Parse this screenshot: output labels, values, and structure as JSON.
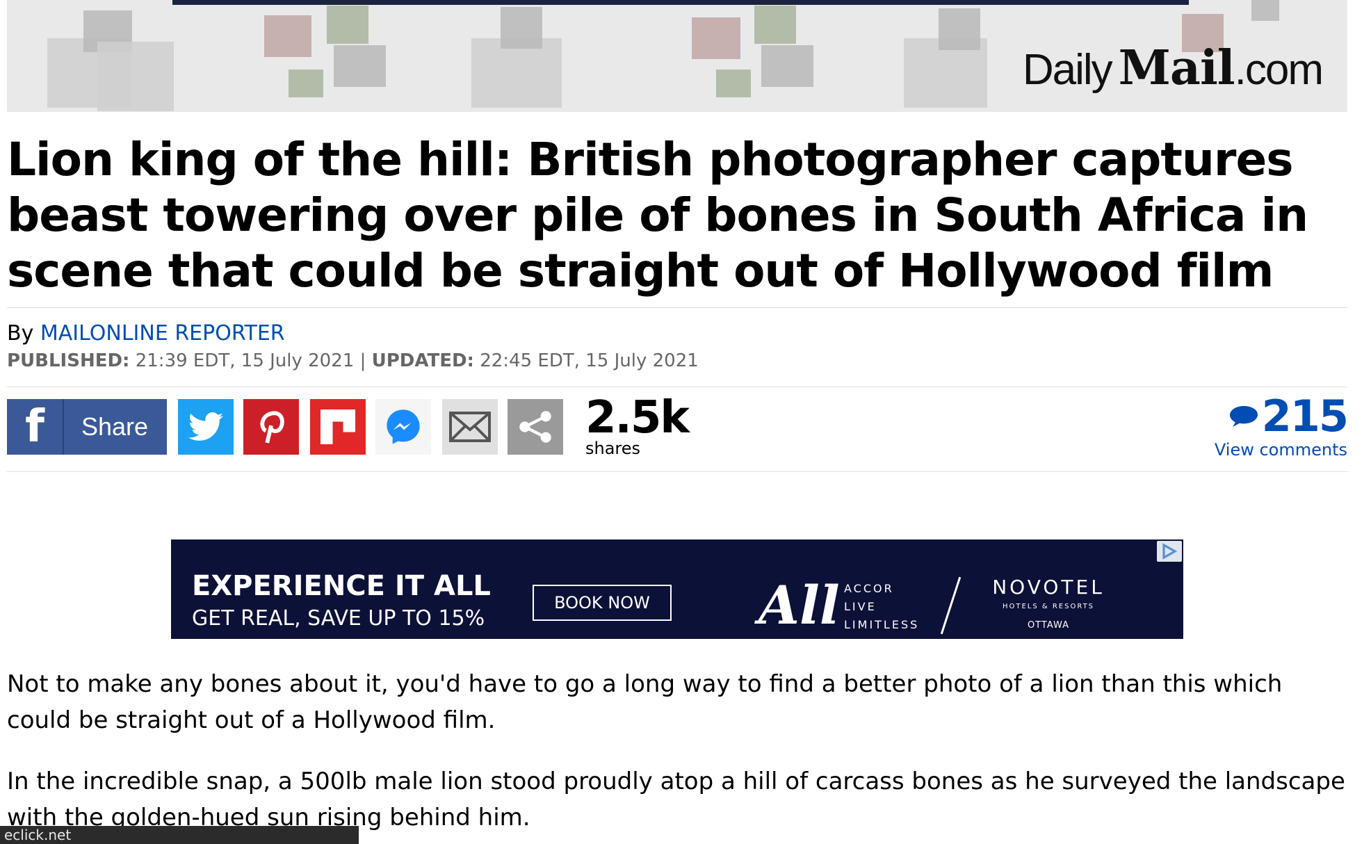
{
  "masthead": {
    "logo_daily": "Daily",
    "logo_mail": "Mail",
    "logo_com": ".com"
  },
  "article": {
    "headline": "Lion king of the hill: British photographer captures beast towering over pile of bones in South Africa in scene that could be straight out of Hollywood film",
    "byline_prefix": "By",
    "author": "MAILONLINE REPORTER",
    "published_label": "PUBLISHED:",
    "published_value": "21:39 EDT, 15 July 2021",
    "separator": "|",
    "updated_label": "UPDATED:",
    "updated_value": "22:45 EDT, 15 July 2021",
    "paragraphs": [
      "Not to make any bones about it, you'd have to go a long way to find a better photo of a lion than this which could be straight out of a Hollywood film.",
      "In the incredible snap, a 500lb male lion stood proudly atop a hill of carcass bones as he surveyed the landscape with the golden-hued sun rising behind him."
    ]
  },
  "share_bar": {
    "facebook_letter": "f",
    "facebook_label": "Share",
    "icons": [
      "twitter-icon",
      "pinterest-icon",
      "flipboard-icon",
      "messenger-icon",
      "email-icon",
      "share-icon"
    ],
    "share_count": "2.5k",
    "share_count_label": "shares",
    "comment_count": "215",
    "comment_link": "View comments",
    "colors": {
      "facebook": "#3b5998",
      "twitter": "#1da1f2",
      "pinterest": "#cb2027",
      "flipboard": "#e12828",
      "link": "#004db3"
    }
  },
  "ad": {
    "headline": "EXPERIENCE IT ALL",
    "subline": "GET REAL, SAVE UP TO 15%",
    "cta": "BOOK NOW",
    "all_mark": "All",
    "accor_lines": [
      "ACCOR",
      "LIVE",
      "LIMITLESS"
    ],
    "brand": "NOVOTEL",
    "brand_sub": "HOTELS & RESORTS",
    "brand_city": "OTTAWA",
    "background": "#0c1138"
  },
  "status_bar": {
    "text": "eclick.net"
  }
}
